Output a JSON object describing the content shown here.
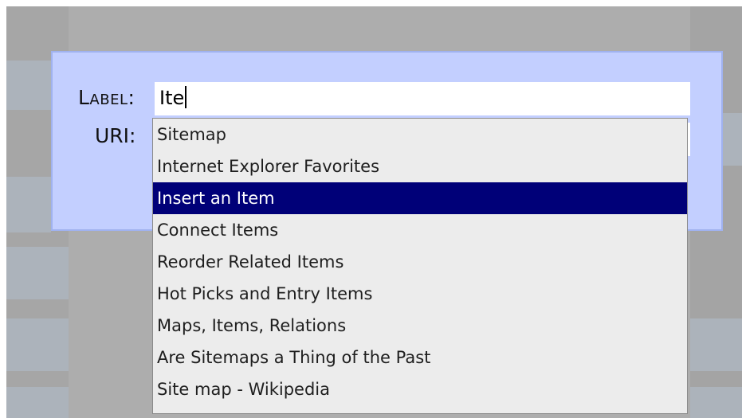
{
  "form": {
    "label_caption": "Label:",
    "uri_caption": "URI:",
    "label_value": "Ite",
    "uri_value": ""
  },
  "autocomplete": {
    "selected_index": 2,
    "items": [
      "Sitemap",
      "Internet Explorer Favorites",
      "Insert an Item",
      "Connect Items",
      "Reorder Related Items",
      "Hot Picks and Entry Items",
      "Maps, Items, Relations",
      "Are Sitemaps a Thing of the Past",
      "Site map - Wikipedia"
    ]
  },
  "colors": {
    "dialog_background": "#c3cfff",
    "selected_background": "#000078",
    "selected_text": "#ffffff",
    "dropdown_background": "#ececec"
  }
}
